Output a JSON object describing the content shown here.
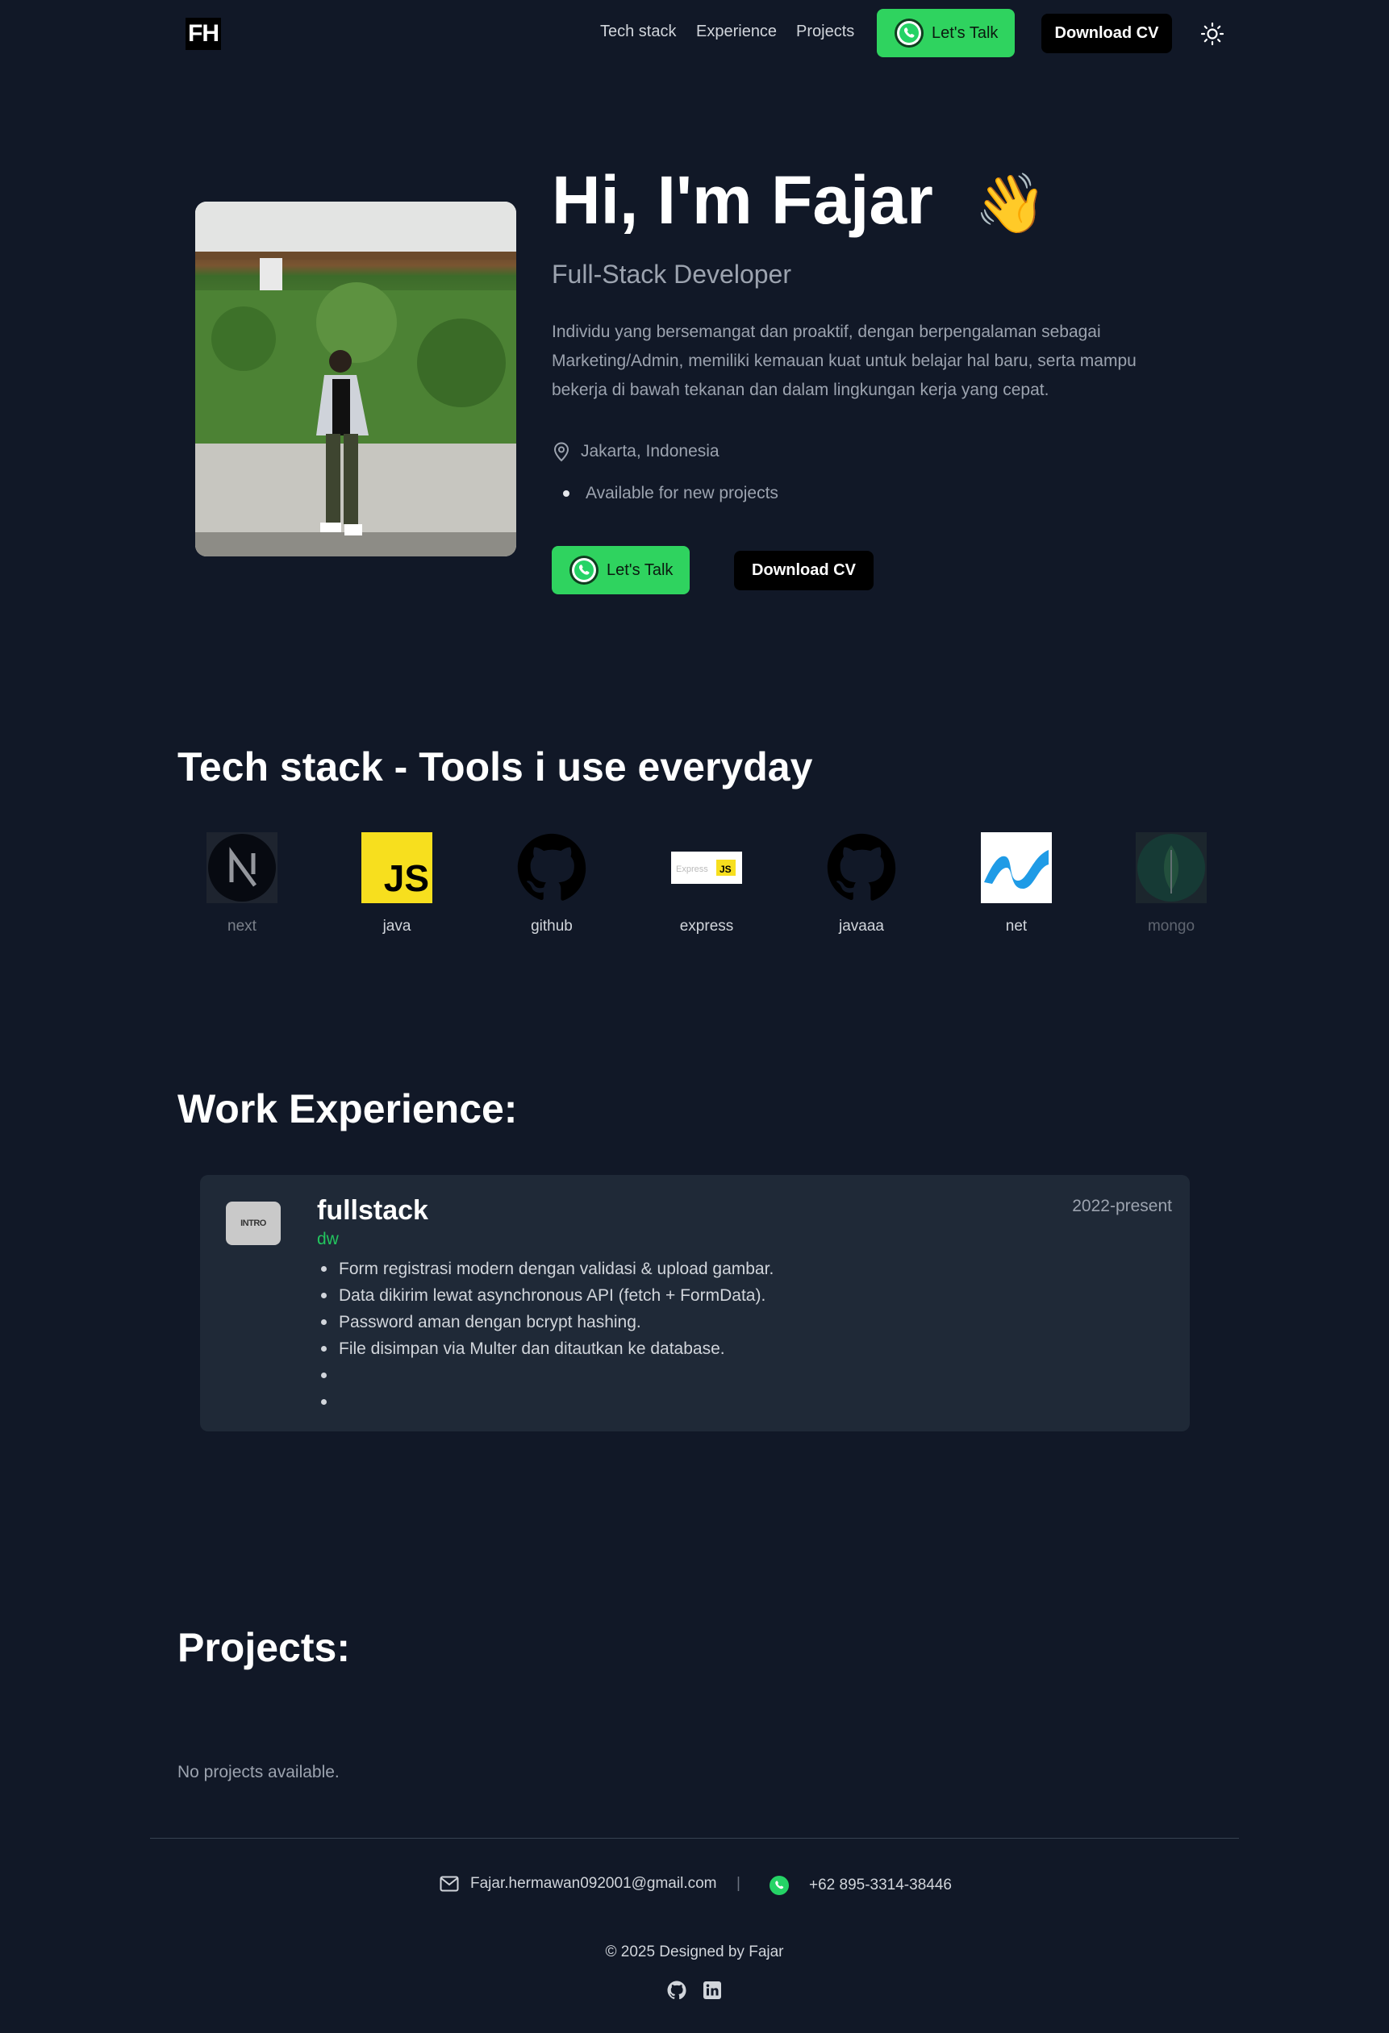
{
  "header": {
    "logo": "FH",
    "nav": [
      "Tech stack",
      "Experience",
      "Projects"
    ],
    "talk_label": "Let's Talk",
    "cv_label": "Download CV",
    "theme_icon": "sun-icon"
  },
  "hero": {
    "title": "Hi, I'm Fajar",
    "wave": "👋",
    "subtitle": "Full-Stack Developer",
    "description": "Individu yang bersemangat dan proaktif, dengan berpengalaman sebagai Marketing/Admin, memiliki kemauan kuat untuk belajar hal baru, serta mampu bekerja di bawah tekanan dan dalam lingkungan kerja yang cepat.",
    "location": "Jakarta, Indonesia",
    "availability": "Available for new projects",
    "talk_label": "Let's Talk",
    "cv_label": "Download CV"
  },
  "tech": {
    "title": "Tech stack - Tools i use everyday",
    "items": [
      {
        "label": "next",
        "icon": "nextjs-icon"
      },
      {
        "label": "java",
        "icon": "javascript-icon"
      },
      {
        "label": "github",
        "icon": "github-icon"
      },
      {
        "label": "express",
        "icon": "express-icon"
      },
      {
        "label": "javaaa",
        "icon": "github-icon"
      },
      {
        "label": "net",
        "icon": "dotnet-icon"
      },
      {
        "label": "mongo",
        "icon": "mongodb-icon"
      }
    ]
  },
  "experience": {
    "title": "Work Experience:",
    "card": {
      "logo_text": "INTRO",
      "role": "fullstack",
      "company": "dw",
      "period": "2022-present",
      "points": [
        "Form registrasi modern dengan validasi & upload gambar.",
        "Data dikirim lewat asynchronous API (fetch + FormData).",
        "Password aman dengan bcrypt hashing.",
        "File disimpan via Multer dan ditautkan ke database.",
        "",
        ""
      ]
    }
  },
  "projects": {
    "title": "Projects:",
    "empty": "No projects available."
  },
  "footer": {
    "email": "Fajar.hermawan092001@gmail.com",
    "separator": "|",
    "phone": "+62 895-3314-38446",
    "copyright": "© 2025 Designed by Fajar"
  },
  "colors": {
    "background": "#111827",
    "card": "#1f2937",
    "whatsapp_green": "#2fd35f",
    "company_green": "#22c55e"
  }
}
